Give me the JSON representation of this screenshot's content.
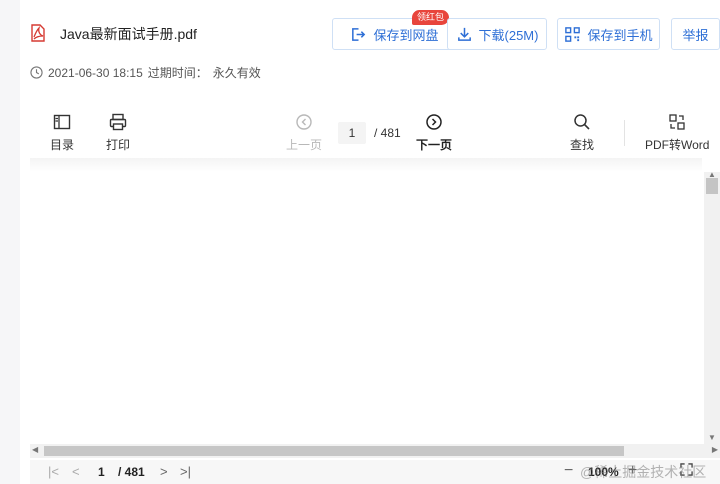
{
  "file": {
    "name": "Java最新面试手册.pdf",
    "date": "2021-06-30 18:15",
    "expire_label": "过期时间：",
    "expire_value": "永久有效"
  },
  "header_buttons": {
    "save_disk": "保存到网盘",
    "badge": "领红包",
    "download": "下载(25M)",
    "save_phone": "保存到手机",
    "report": "举报"
  },
  "toolbar": {
    "toc": "目录",
    "print": "打印",
    "prev": "上一页",
    "current_page": "1",
    "total": "/  481",
    "next": "下一页",
    "search": "查找",
    "convert": "PDF转Word"
  },
  "bottom": {
    "page": "1",
    "total": "/ 481",
    "zoom": "100%"
  },
  "watermark": "@稀土掘金技术社区",
  "colors": {
    "accent": "#2e6fd6",
    "badge": "#e8453c",
    "pdf_icon": "#d63a32"
  }
}
